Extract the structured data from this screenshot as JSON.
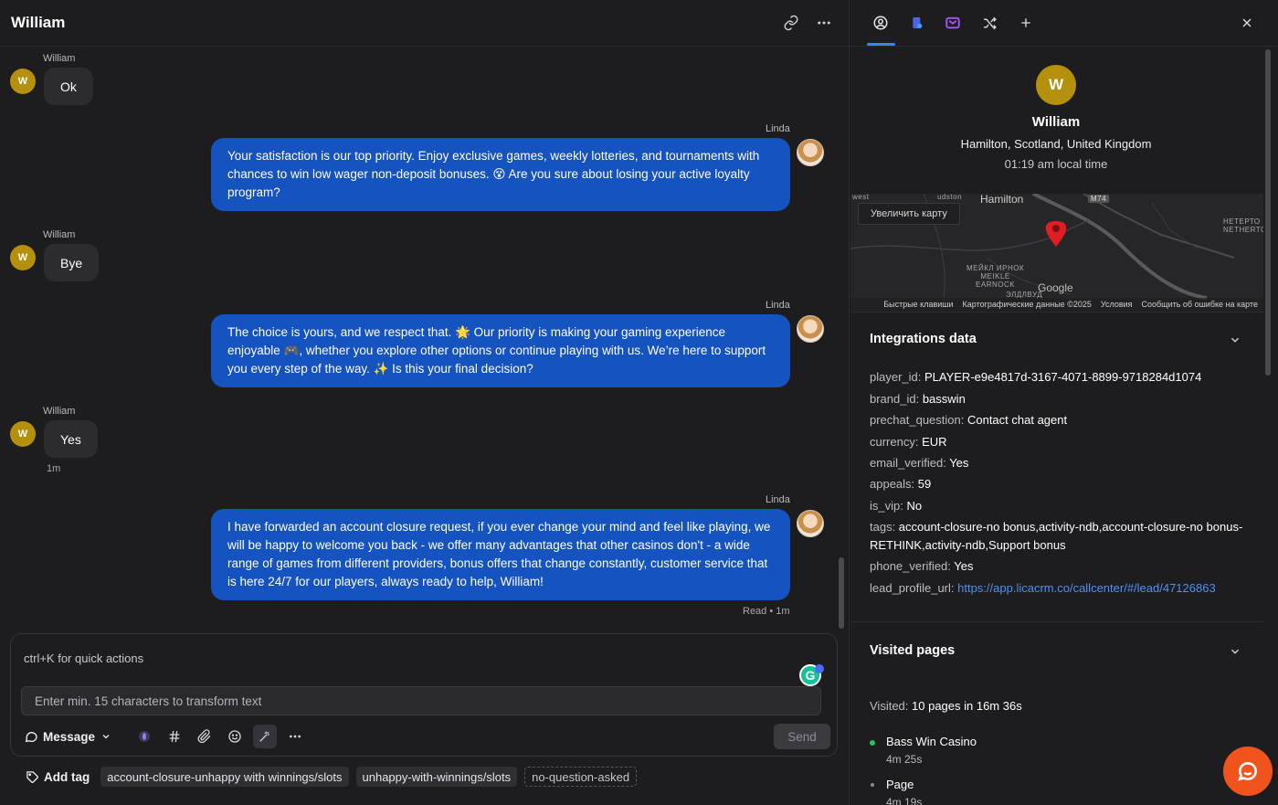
{
  "header": {
    "title": "William"
  },
  "conversation": [
    {
      "type": "in",
      "sender": "William",
      "avatar": "W",
      "text": "Ok"
    },
    {
      "type": "out",
      "sender": "Linda",
      "text": "Your satisfaction is our top priority. Enjoy exclusive games, weekly lotteries, and tournaments with chances to win low wager non-deposit bonuses. 😵 Are you sure about losing your active loyalty program?"
    },
    {
      "type": "in",
      "sender": "William",
      "avatar": "W",
      "text": "Bye"
    },
    {
      "type": "out",
      "sender": "Linda",
      "text": "The choice is yours, and we respect that. 🌟 Our priority is making your gaming experience enjoyable 🎮, whether you explore other options or continue playing with us. We’re here to support you every step of the way. ✨ Is this your final decision?"
    },
    {
      "type": "in",
      "sender": "William",
      "avatar": "W",
      "text": "Yes",
      "time": "1m"
    },
    {
      "type": "out",
      "sender": "Linda",
      "text": "I have forwarded an account closure request, if you ever change your mind and feel like playing, we will be happy to welcome you back - we offer many advantages that other casinos don't - a wide range of games from different providers, bonus offers that change constantly, customer service that is here 24/7 for our players, always ready to help, William!",
      "status": "Read • 1m"
    }
  ],
  "composer": {
    "hint": "ctrl+K for quick actions",
    "transform_placeholder": "Enter min. 15 characters to transform text",
    "mode_label": "Message",
    "send_label": "Send",
    "grammarly": "G"
  },
  "tags": {
    "add_label": "Add tag",
    "items": [
      "account-closure-unhappy with winnings/slots",
      "unhappy-with-winnings/slots"
    ],
    "suggested": "no-question-asked"
  },
  "profile": {
    "initial": "W",
    "name": "William",
    "location": "Hamilton, Scotland, United Kingdom",
    "local_time": "01:19 am local time"
  },
  "map": {
    "enlarge": "Увеличить карту",
    "city": "Hamilton",
    "road": "M74",
    "district1": "МЕЙКЛ ИРНОК\nMEIKLE\nEARNOCK",
    "district2": "НЕТЕРТО\nNETHERTO",
    "district3": "ЭЛДЛВУД",
    "top1": "west",
    "top2": "udston",
    "google": "Google",
    "footer": [
      "Быстрые клавиши",
      "Картографические данные ©2025",
      "Условия",
      "Сообщить об ошибке на карте"
    ]
  },
  "integrations": {
    "title": "Integrations data",
    "rows": [
      {
        "k": "player_id: ",
        "v": "PLAYER-e9e4817d-3167-4071-8899-9718284d1074"
      },
      {
        "k": "brand_id: ",
        "v": "basswin"
      },
      {
        "k": "prechat_question: ",
        "v": "Contact chat agent"
      },
      {
        "k": "currency: ",
        "v": "EUR"
      },
      {
        "k": "email_verified: ",
        "v": "Yes"
      },
      {
        "k": "appeals: ",
        "v": "59"
      },
      {
        "k": "is_vip: ",
        "v": "No"
      },
      {
        "k": "tags: ",
        "v": "account-closure-no bonus,activity-ndb,account-closure-no bonus-RETHINK,activity-ndb,Support bonus"
      },
      {
        "k": "phone_verified: ",
        "v": "Yes"
      }
    ],
    "lead_key": "lead_profile_url: ",
    "lead_url": "https://app.licacrm.co/callcenter/#/lead/47126863"
  },
  "visited": {
    "title": "Visited pages",
    "summary_key": "Visited: ",
    "summary_val": "10 pages in 16m 36s",
    "pages": [
      {
        "title": "Bass Win Casino",
        "duration": "4m 25s",
        "color": "#22c55e"
      },
      {
        "title": "Page",
        "duration": "4m 19s",
        "color": "#8a8a90"
      }
    ]
  },
  "colors": {
    "accent": "#3b82f6",
    "bubble_out": "#1553c0",
    "avatar": "#b5900c",
    "widget": "#f0531c"
  }
}
